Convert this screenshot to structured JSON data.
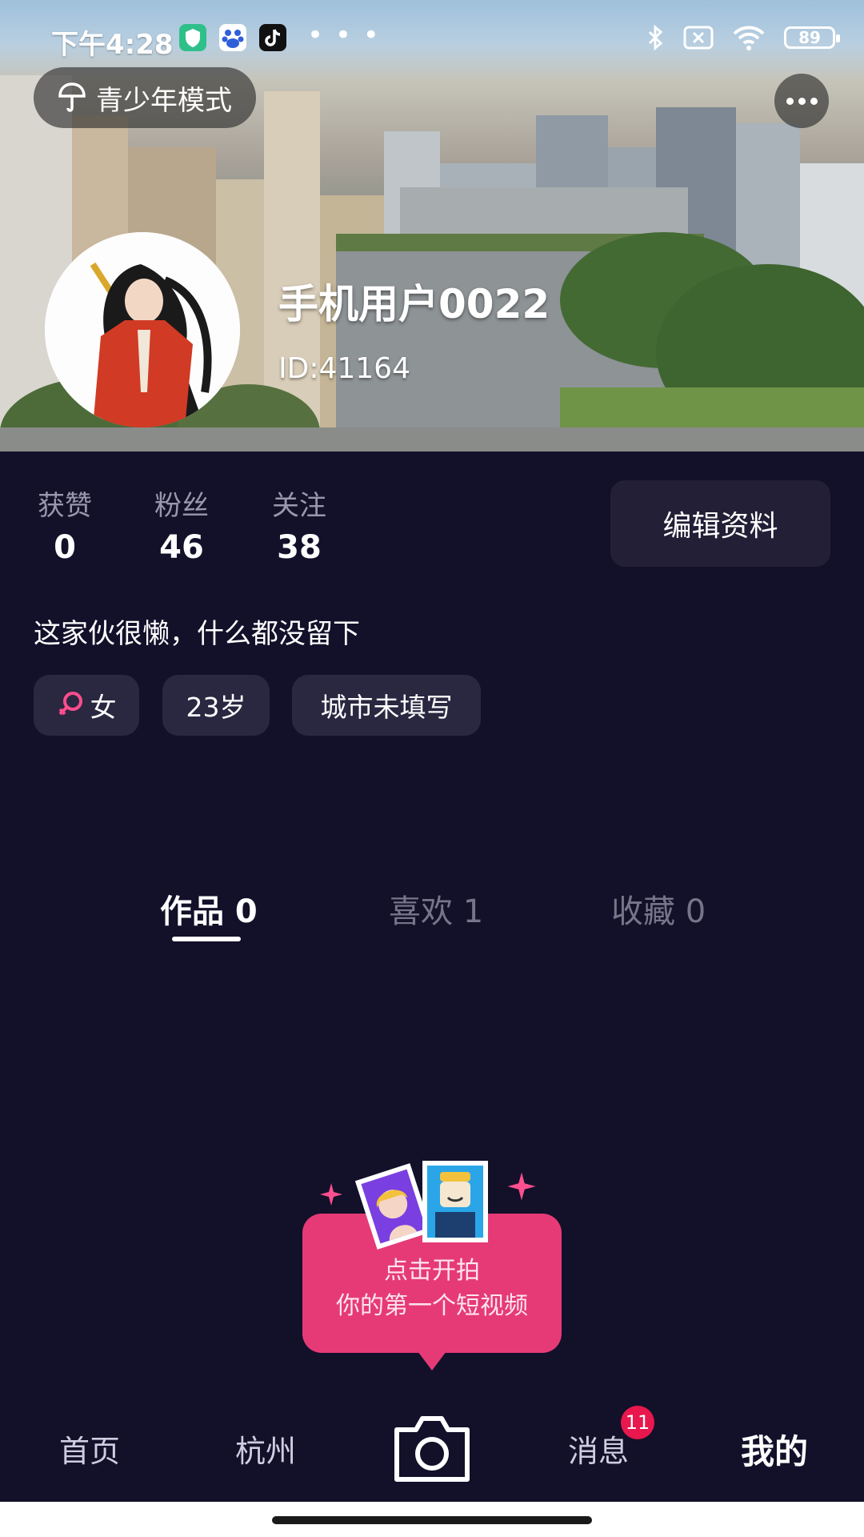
{
  "status_bar": {
    "time": "下午4:28",
    "battery": "89",
    "app_icons": [
      "shield-app-icon",
      "baidu-app-icon",
      "tiktok-app-icon"
    ]
  },
  "header": {
    "youth_mode_label": "青少年模式",
    "username": "手机用户0022",
    "user_id": "ID:41164"
  },
  "stats": [
    {
      "label": "获赞",
      "value": "0"
    },
    {
      "label": "粉丝",
      "value": "46"
    },
    {
      "label": "关注",
      "value": "38"
    }
  ],
  "edit_profile_label": "编辑资料",
  "bio": "这家伙很懒，什么都没留下",
  "tags": {
    "gender": "女",
    "age": "23岁",
    "city": "城市未填写"
  },
  "tabs": [
    {
      "label": "作品 0",
      "active": true
    },
    {
      "label": "喜欢 1",
      "active": false
    },
    {
      "label": "收藏 0",
      "active": false
    }
  ],
  "promo": {
    "line1": "点击开拍",
    "line2": "你的第一个短视频"
  },
  "nav": {
    "home": "首页",
    "city": "杭州",
    "messages": "消息",
    "messages_badge": "11",
    "me": "我的"
  },
  "colors": {
    "background": "#13102a",
    "accent_pink": "#e63a77",
    "badge_red": "#e8174d",
    "chip_bg": "#2a2740"
  }
}
